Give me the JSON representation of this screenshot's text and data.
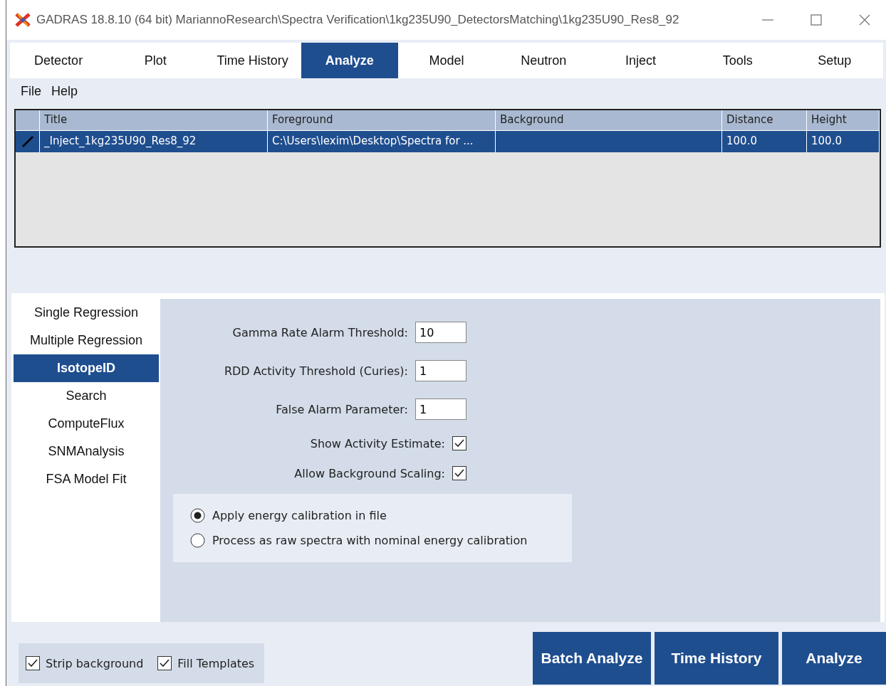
{
  "window": {
    "title": "GADRAS 18.8.10 (64 bit) MariannoResearch\\Spectra Verification\\1kg235U90_DetectorsMatching\\1kg235U90_Res8_92"
  },
  "tabs": [
    {
      "label": "Detector",
      "selected": false
    },
    {
      "label": "Plot",
      "selected": false
    },
    {
      "label": "Time History",
      "selected": false
    },
    {
      "label": "Analyze",
      "selected": true
    },
    {
      "label": "Model",
      "selected": false
    },
    {
      "label": "Neutron",
      "selected": false
    },
    {
      "label": "Inject",
      "selected": false
    },
    {
      "label": "Tools",
      "selected": false
    },
    {
      "label": "Setup",
      "selected": false
    }
  ],
  "menu": [
    "File",
    "Help"
  ],
  "table": {
    "columns": [
      "Title",
      "Foreground",
      "Background",
      "Distance",
      "Height"
    ],
    "rows": [
      {
        "selected": true,
        "cells": [
          "_Inject_1kg235U90_Res8_92",
          "C:\\Users\\lexim\\Desktop\\Spectra for ...",
          "",
          "100.0",
          "100.0"
        ]
      }
    ]
  },
  "analysis_list": [
    {
      "label": "Single Regression",
      "selected": false
    },
    {
      "label": "Multiple Regression",
      "selected": false
    },
    {
      "label": "IsotopeID",
      "selected": true
    },
    {
      "label": "Search",
      "selected": false
    },
    {
      "label": "ComputeFlux",
      "selected": false
    },
    {
      "label": "SNMAnalysis",
      "selected": false
    },
    {
      "label": "FSA Model Fit",
      "selected": false
    }
  ],
  "settings": [
    {
      "kind": "field",
      "label": "Gamma Rate Alarm Threshold:",
      "value": "10"
    },
    {
      "kind": "field",
      "label": "RDD Activity Threshold (Curies):",
      "value": "1"
    },
    {
      "kind": "field",
      "label": "False Alarm Parameter:",
      "value": "1"
    },
    {
      "kind": "checkbox",
      "label": "Show Activity Estimate:",
      "checked": true
    },
    {
      "kind": "checkbox",
      "label": "Allow Background Scaling:",
      "checked": true
    }
  ],
  "calibration": [
    {
      "label": "Apply energy calibration in file",
      "selected": true
    },
    {
      "label": "Process as raw spectra with nominal energy calibration",
      "selected": false
    }
  ],
  "options": [
    {
      "label": "Strip background",
      "checked": true
    },
    {
      "label": "Fill Templates",
      "checked": true
    }
  ],
  "buttons": [
    "Batch Analyze",
    "Time History",
    "Analyze"
  ]
}
